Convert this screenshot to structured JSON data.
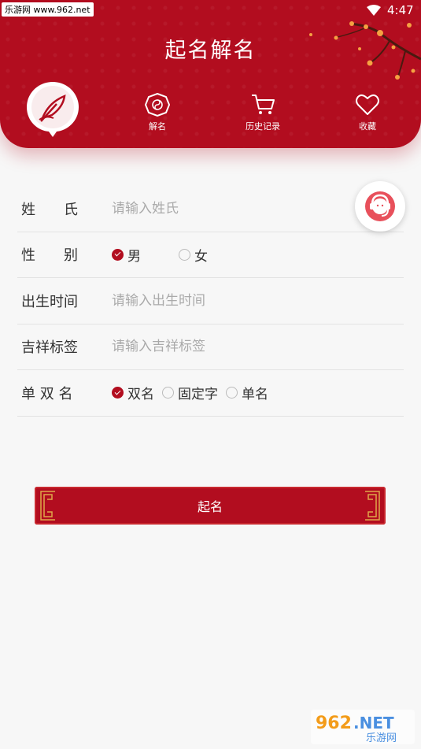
{
  "status_bar": {
    "watermark": "乐游网 www.962.net",
    "time": "4:47"
  },
  "header": {
    "title": "起名解名"
  },
  "nav": [
    {
      "label": "解名",
      "icon": "bagua-icon"
    },
    {
      "label": "历史记录",
      "icon": "cart-icon"
    },
    {
      "label": "收藏",
      "icon": "heart-icon"
    }
  ],
  "form": {
    "surname": {
      "label": "姓　　氏",
      "placeholder": "请输入姓氏"
    },
    "gender": {
      "label": "性　　别",
      "options": [
        {
          "label": "男",
          "selected": true
        },
        {
          "label": "女",
          "selected": false
        }
      ]
    },
    "birth": {
      "label": "出生时间",
      "placeholder": "请输入出生时间"
    },
    "tag": {
      "label": "吉祥标签",
      "placeholder": "请输入吉祥标签"
    },
    "name_type": {
      "label": "单 双 名",
      "options": [
        {
          "label": "双名",
          "selected": true
        },
        {
          "label": "固定字",
          "selected": false
        },
        {
          "label": "单名",
          "selected": false
        }
      ]
    }
  },
  "submit": {
    "label": "起名"
  },
  "watermark_bottom": {
    "top": "962",
    "suffix": ".NET",
    "text": "乐游网"
  },
  "colors": {
    "primary": "#b20d1f",
    "background": "#f7f7f7"
  }
}
